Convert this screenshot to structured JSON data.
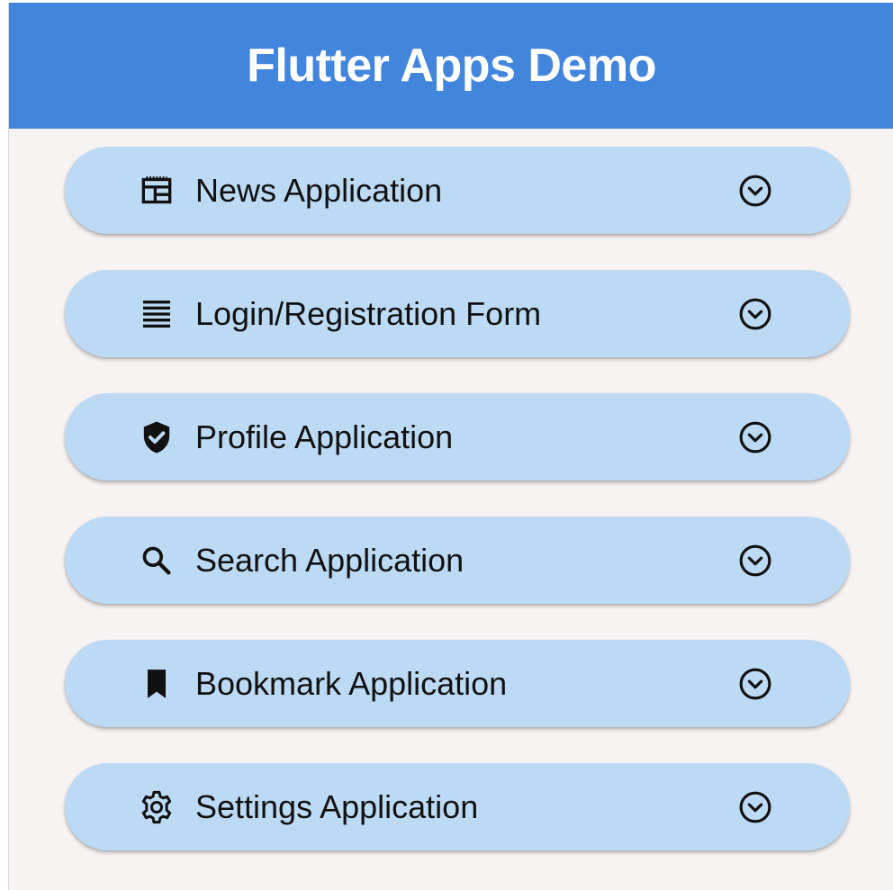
{
  "appbar": {
    "title": "Flutter Apps Demo",
    "color": "#4285dc"
  },
  "tiles": [
    {
      "label": "News Application",
      "icon": "newspaper-icon"
    },
    {
      "label": "Login/Registration Form",
      "icon": "list-lines-icon"
    },
    {
      "label": "Profile Application",
      "icon": "verified-shield-icon"
    },
    {
      "label": "Search Application",
      "icon": "search-icon"
    },
    {
      "label": "Bookmark Application",
      "icon": "bookmark-icon"
    },
    {
      "label": "Settings Application",
      "icon": "gear-icon"
    }
  ],
  "colors": {
    "background": "#f8f3f3",
    "tile": "#bddaf5"
  }
}
